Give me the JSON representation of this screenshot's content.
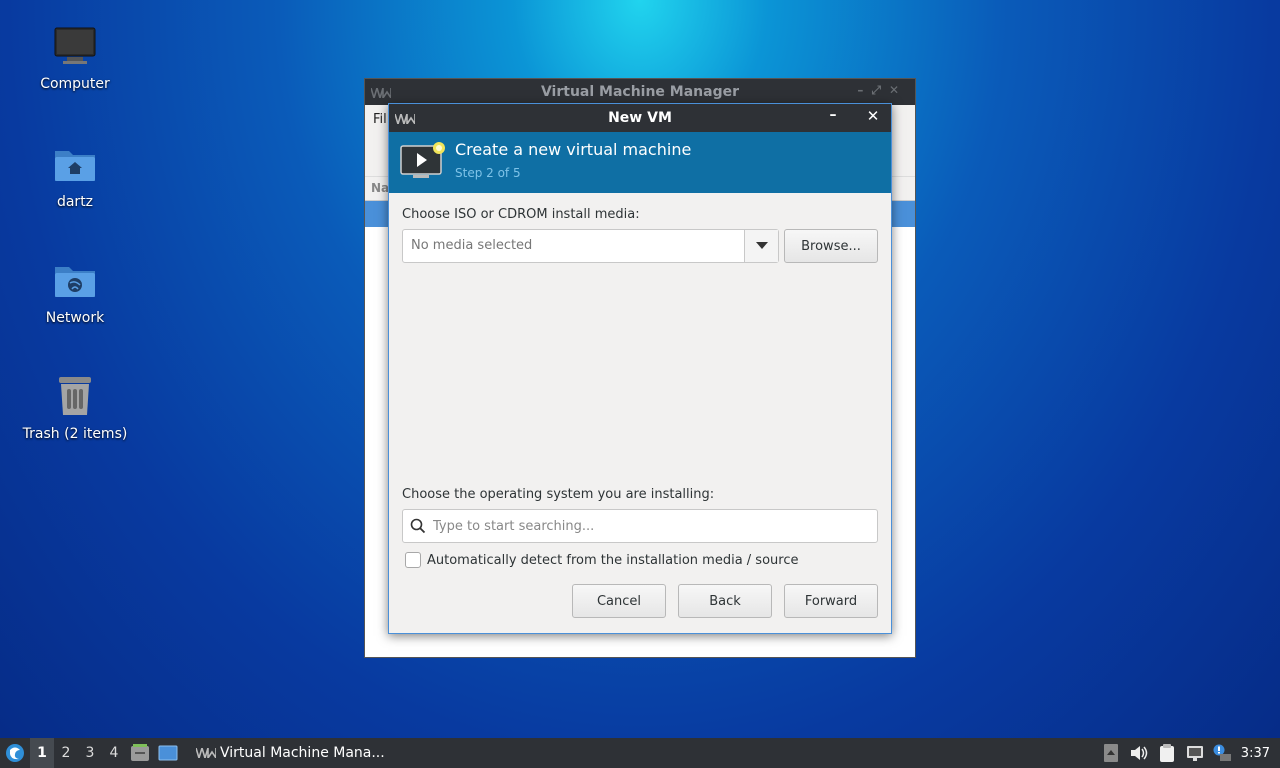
{
  "desktop": {
    "icons": [
      {
        "label": "Computer",
        "icon": "computer-icon"
      },
      {
        "label": "dartz",
        "icon": "home-folder-icon"
      },
      {
        "label": "Network",
        "icon": "network-icon"
      },
      {
        "label": "Trash (2 items)",
        "icon": "trash-icon"
      }
    ]
  },
  "background_window": {
    "title": "Virtual Machine Manager",
    "menu_partial": "Fil",
    "column_partial": "Na"
  },
  "dialog": {
    "title": "New VM",
    "header_title": "Create a new virtual machine",
    "header_step": "Step 2 of 5",
    "media_label": "Choose ISO or CDROM install media:",
    "media_value": "No media selected",
    "browse_label": "Browse...",
    "os_label": "Choose the operating system you are installing:",
    "os_search_placeholder": "Type to start searching...",
    "auto_detect_label": "Automatically detect from the installation media / source",
    "auto_detect_checked": false,
    "cancel_label": "Cancel",
    "back_label": "Back",
    "forward_label": "Forward"
  },
  "taskbar": {
    "workspaces": [
      "1",
      "2",
      "3",
      "4"
    ],
    "active_workspace": "1",
    "task_label": "Virtual Machine Mana...",
    "clock": "3:37"
  },
  "colors": {
    "header_blue": "#0f6fa4",
    "selection_blue": "#4a90d9",
    "titlebar_dark": "#2e3136"
  }
}
